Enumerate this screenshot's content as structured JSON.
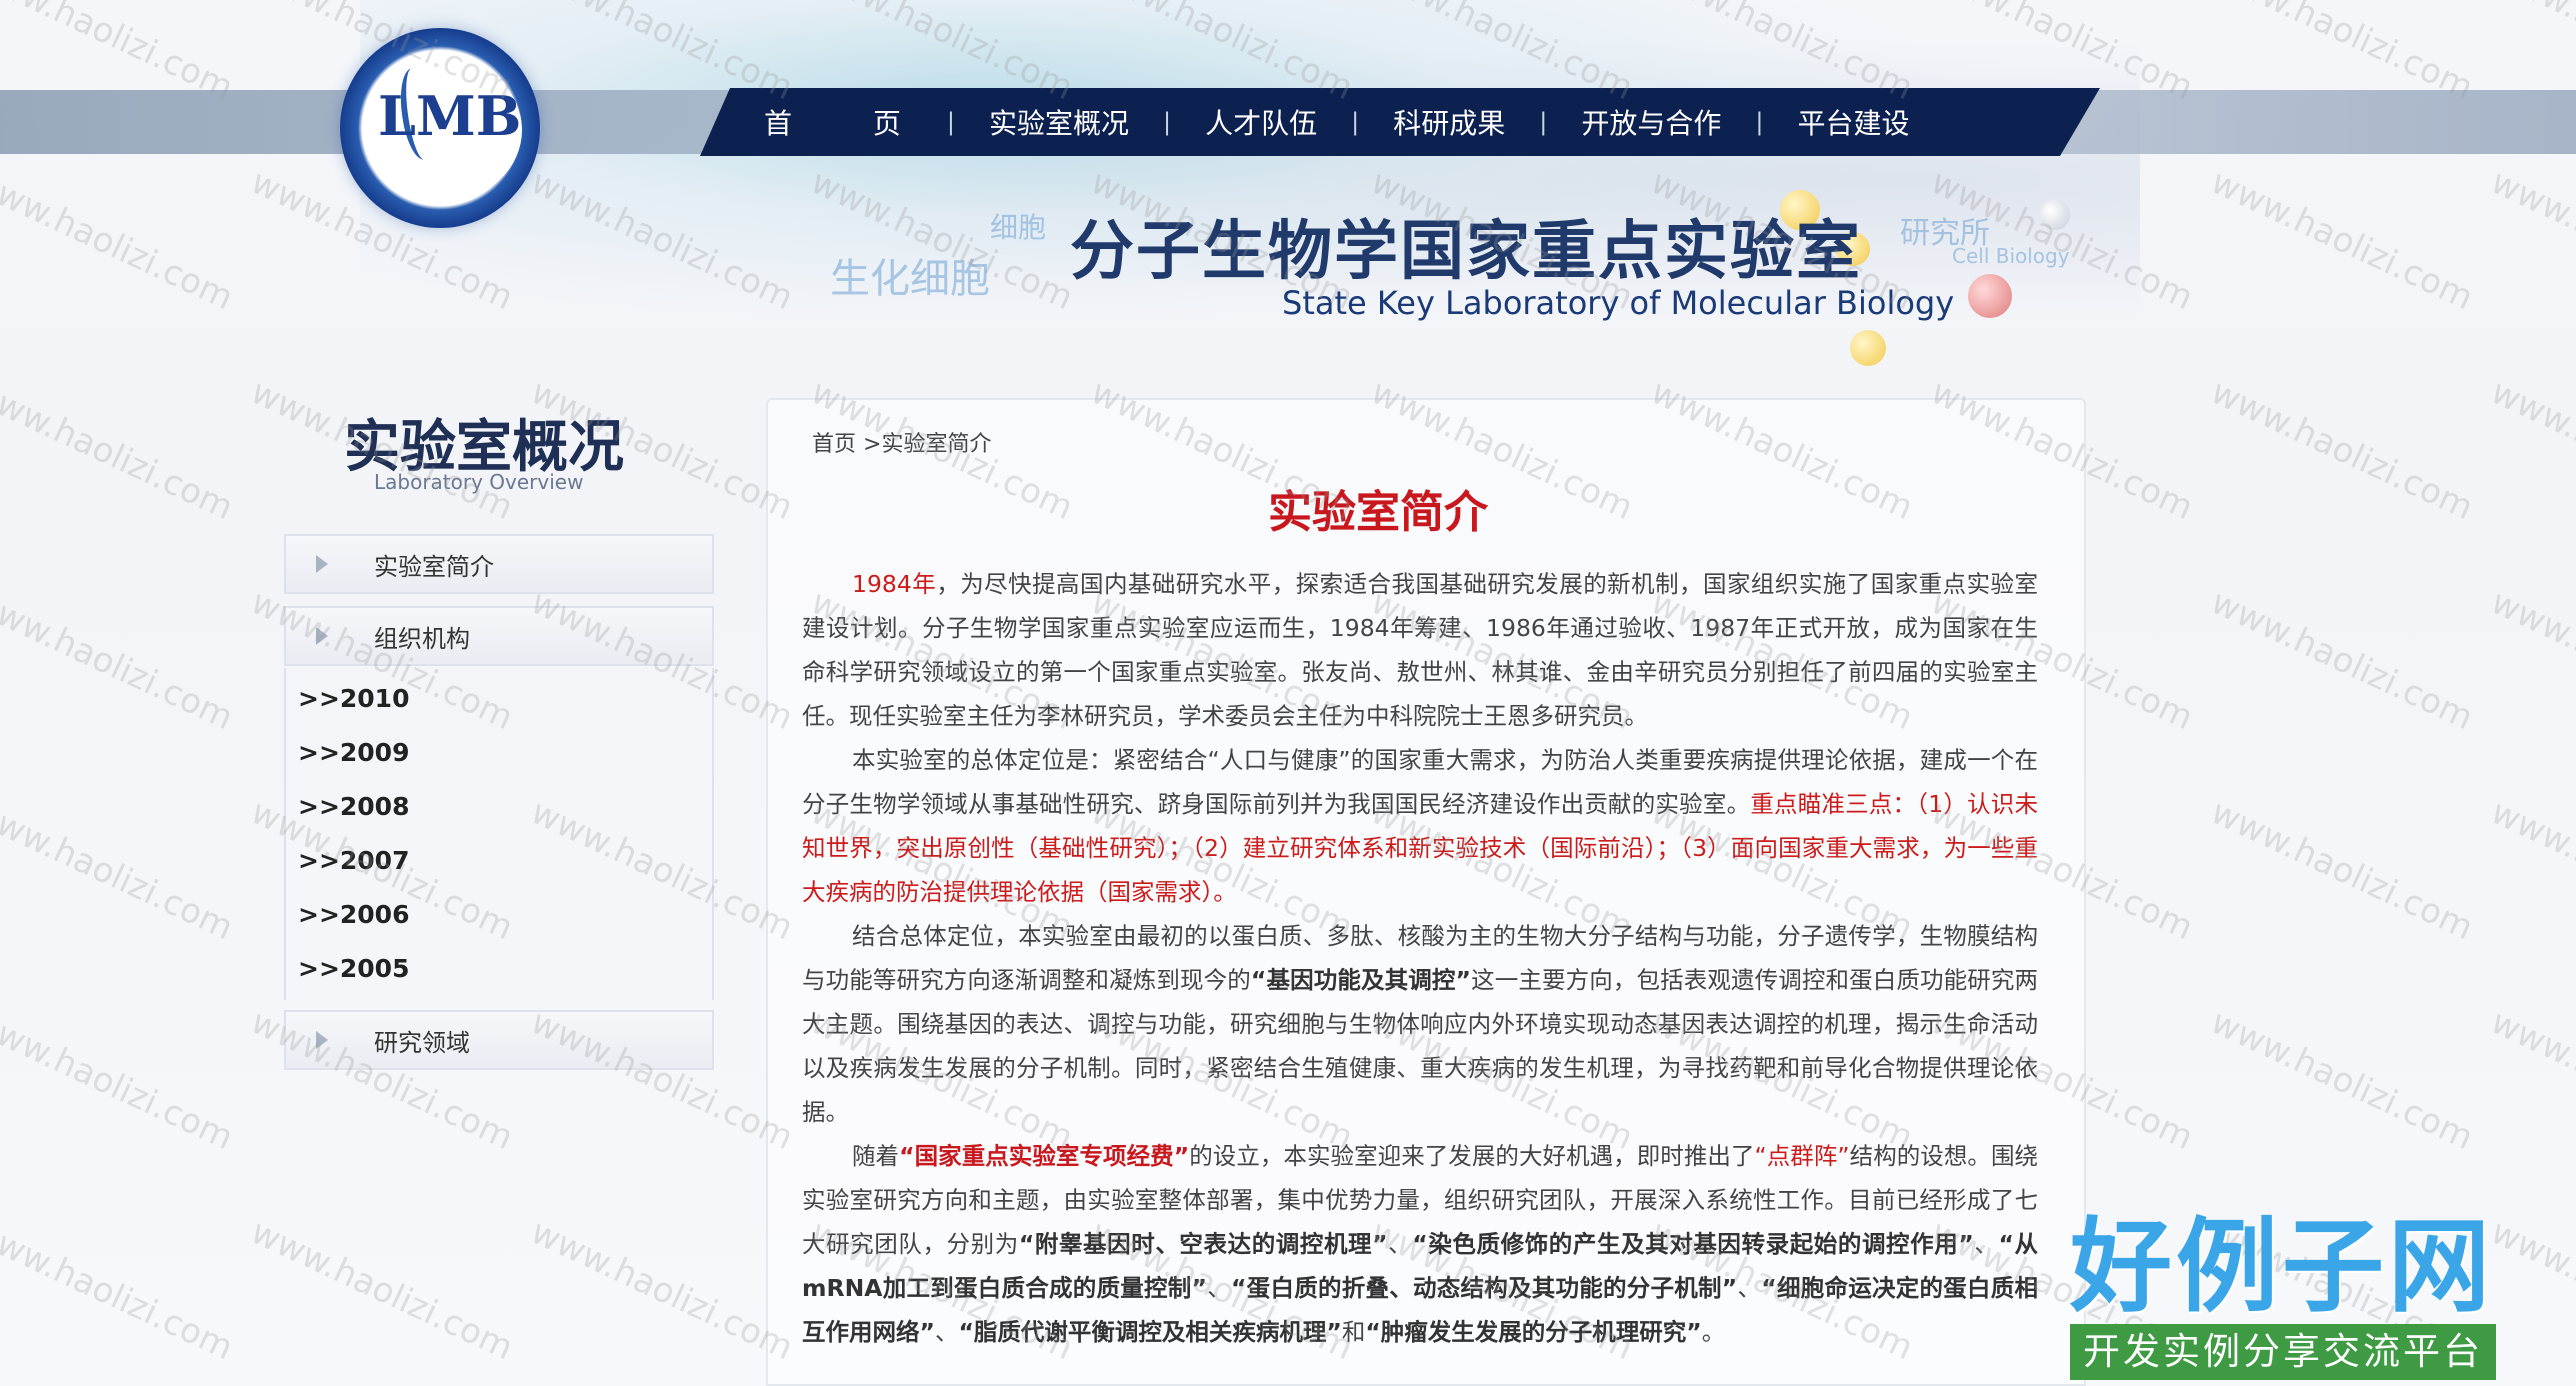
{
  "header": {
    "logo_text": "LMB",
    "title_cn": "分子生物学国家重点实验室",
    "title_en": "State Key Laboratory of Molecular Biology",
    "faint_1": "生化细胞",
    "faint_2": "细胞",
    "faint_3": "研究所",
    "faint_4": "Cell Biology"
  },
  "nav": {
    "items": [
      {
        "label": "首 页"
      },
      {
        "label": "实验室概况"
      },
      {
        "label": "人才队伍"
      },
      {
        "label": "科研成果"
      },
      {
        "label": "开放与合作"
      },
      {
        "label": "平台建设"
      }
    ],
    "separator": "|"
  },
  "sidebar": {
    "title": "实验室概况",
    "subtitle": "Laboratory Overview",
    "items": [
      {
        "label": "实验室简介"
      },
      {
        "label": "组织机构"
      },
      {
        "label": "研究领域"
      }
    ],
    "years": [
      ">>2010",
      ">>2009",
      ">>2008",
      ">>2007",
      ">>2006",
      ">>2005"
    ]
  },
  "breadcrumb": {
    "home": "首页",
    "sep": " >",
    "current": "实验室简介"
  },
  "article": {
    "title": "实验室简介",
    "p1": {
      "year": "1984年",
      "text": "，为尽快提高国内基础研究水平，探索适合我国基础研究发展的新机制，国家组织实施了国家重点实验室建设计划。分子生物学国家重点实验室应运而生，1984年筹建、1986年通过验收、1987年正式开放，成为国家在生命科学研究领域设立的第一个国家重点实验室。张友尚、敖世州、林其谁、金由辛研究员分别担任了前四届的实验室主任。现任实验室主任为李林研究员，学术委员会主任为中科院院士王恩多研究员。"
    },
    "p2": {
      "text": "本实验室的总体定位是：紧密结合“人口与健康”的国家重大需求，为防治人类重要疾病提供理论依据，建成一个在分子生物学领域从事基础性研究、跻身国际前列并为我国国民经济建设作出贡献的实验室。",
      "red": "重点瞄准三点：（1）认识未知世界，突出原创性（基础性研究）；（2）建立研究体系和新实验技术（国际前沿）；（3）面向国家重大需求，为一些重大疾病的防治提供理论依据（国家需求）。"
    },
    "p3": {
      "a": "结合总体定位，本实验室由最初的以蛋白质、多肽、核酸为主的生物大分子结构与功能，分子遗传学，生物膜结构与功能等研究方向逐渐调整和凝炼到现今的",
      "bold": "“基因功能及其调控”",
      "b": "这一主要方向，包括表观遗传调控和蛋白质功能研究两大主题。围绕基因的表达、调控与功能，研究细胞与生物体响应内外环境实现动态基因表达调控的机理，揭示生命活动以及疾病发生发展的分子机制。同时，紧密结合生殖健康、重大疾病的发生机理，为寻找药靶和前导化合物提供理论依据。"
    },
    "p4": {
      "a": "随着",
      "red1": "“国家重点实验室专项经费”",
      "b": "的设立，本实验室迎来了发展的大好机遇，即时推出了",
      "red2": "“点群阵”",
      "c": "结构的设想。围绕实验室研究方向和主题，由实验室整体部署，集中优势力量，组织研究团队，开展深入系统性工作。目前已经形成了七大研究团队，分别为",
      "t1": "“附睾基因时、空表达的调控机理”",
      "s1": "、",
      "t2": "“染色质修饰的产生及其对基因转录起始的调控作用”",
      "s2": "、",
      "t3": "“从mRNA加工到蛋白质合成的质量控制”",
      "s3": "、",
      "t4": "“蛋白质的折叠、动态结构及其功能的分子机制”",
      "s4": "、",
      "t5": "“细胞命运决定的蛋白质相互作用网络”",
      "s5": "、",
      "t6": "“脂质代谢平衡调控及相关疾病机理”",
      "s6": "和",
      "t7": "“肿瘤发生发展的分子机理研究”",
      "end": "。"
    }
  },
  "watermark": "www.haolizi.com",
  "site_logo": {
    "cn": "好例子网",
    "sub": "开发实例分享交流平台"
  },
  "colors": {
    "nav_bg": "#0d2150",
    "title_red": "#c8171d",
    "logo_blue": "#3aa6e8",
    "logo_green": "#3e9a43"
  }
}
